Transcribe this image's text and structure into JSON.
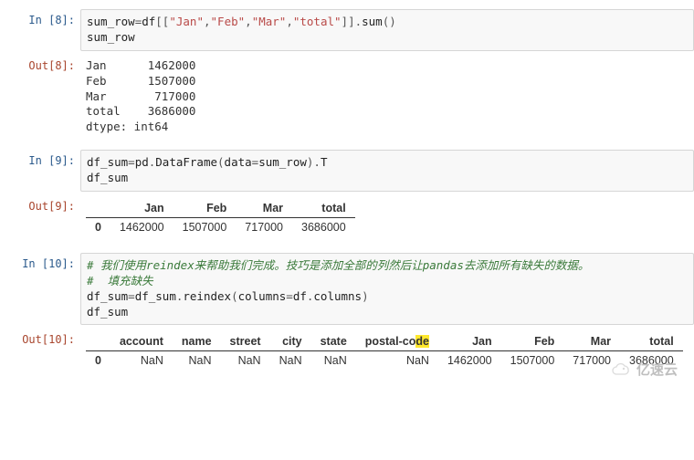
{
  "cells": [
    {
      "in_prompt": "In [8]:",
      "out_prompt": "Out[8]:",
      "code_html": "<span class='var'>sum_row</span><span class='op'>=</span><span class='var'>df</span><span class='op'>[[</span><span class='str'>\"Jan\"</span><span class='op'>,</span><span class='str'>\"Feb\"</span><span class='op'>,</span><span class='str'>\"Mar\"</span><span class='op'>,</span><span class='str'>\"total\"</span><span class='op'>]].</span><span class='func'>sum</span><span class='op'>()</span>\n<span class='var'>sum_row</span>",
      "plain_out": "Jan      1462000\nFeb      1507000\nMar       717000\ntotal    3686000\ndtype: int64"
    },
    {
      "in_prompt": "In [9]:",
      "out_prompt": "Out[9]:",
      "code_html": "<span class='var'>df_sum</span><span class='op'>=</span><span class='var'>pd</span><span class='op'>.</span><span class='func'>DataFrame</span><span class='op'>(</span><span class='var'>data</span><span class='op'>=</span><span class='var'>sum_row</span><span class='op'>).</span><span class='var'>T</span>\n<span class='var'>df_sum</span>",
      "table": {
        "index_name": "0",
        "columns": [
          "Jan",
          "Feb",
          "Mar",
          "total"
        ],
        "rows": [
          [
            "1462000",
            "1507000",
            "717000",
            "3686000"
          ]
        ]
      }
    },
    {
      "in_prompt": "In [10]:",
      "out_prompt": "Out[10]:",
      "code_html": "<span class='comment'># 我们使用reindex来帮助我们完成。技巧是添加全部的列然后让pandas去添加所有缺失的数据。</span>\n<span class='comment'>#  填充缺失</span>\n<span class='var'>df_sum</span><span class='op'>=</span><span class='var'>df_sum</span><span class='op'>.</span><span class='func'>reindex</span><span class='op'>(</span><span class='var'>columns</span><span class='op'>=</span><span class='var'>df</span><span class='op'>.</span><span class='var'>columns</span><span class='op'>)</span>\n<span class='var'>df_sum</span>",
      "table": {
        "index_name": "0",
        "columns": [
          "account",
          "name",
          "street",
          "city",
          "state",
          "postal-code",
          "Jan",
          "Feb",
          "Mar",
          "total"
        ],
        "highlight_col": 5,
        "highlight_text": "de",
        "rows": [
          [
            "NaN",
            "NaN",
            "NaN",
            "NaN",
            "NaN",
            "NaN",
            "1462000",
            "1507000",
            "717000",
            "3686000"
          ]
        ]
      }
    }
  ],
  "watermark_text": "亿速云"
}
